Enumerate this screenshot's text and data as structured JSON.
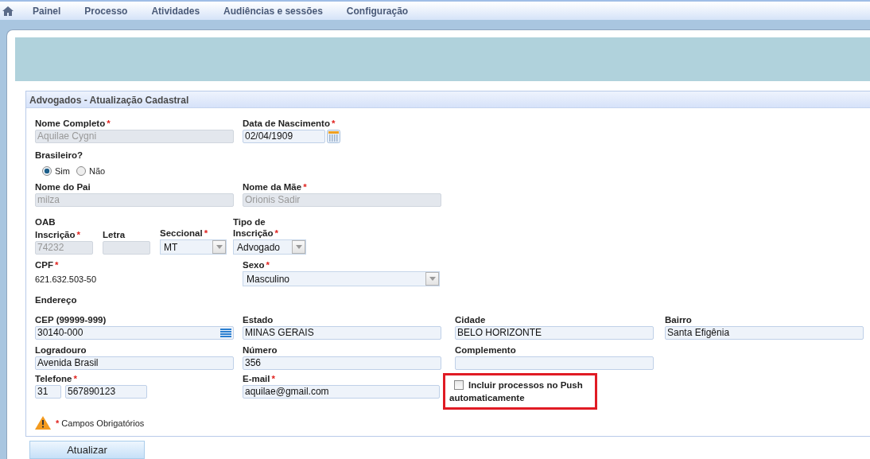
{
  "nav": {
    "items": [
      {
        "label": "Painel"
      },
      {
        "label": "Processo"
      },
      {
        "label": "Atividades"
      },
      {
        "label": "Audiências e sessões"
      },
      {
        "label": "Configuração"
      }
    ]
  },
  "panel": {
    "title": "Advogados - Atualização Cadastral"
  },
  "full_name": {
    "label": "Nome Completo",
    "mark": "*",
    "value": "Aquilae Cygni",
    "disabled": true
  },
  "birth_date": {
    "label": "Data de Nascimento",
    "mark": "*",
    "value": "02/04/1909",
    "disabled": false
  },
  "brazilian": {
    "label": "Brasileiro?",
    "options": [
      {
        "label": "Sim",
        "selected": true
      },
      {
        "label": "Não",
        "selected": false
      }
    ]
  },
  "father": {
    "label": "Nome do Pai",
    "value": "milza",
    "disabled": true
  },
  "mother": {
    "label": "Nome da Mãe",
    "mark": "*",
    "value": "Orionis Sadir",
    "disabled": true
  },
  "oab": {
    "heading": "OAB",
    "fields": [
      {
        "kind": "text",
        "label": "Inscrição",
        "mark": "*",
        "value": "74232",
        "disabled": true
      },
      {
        "kind": "text",
        "label": "Letra",
        "disabled": true
      },
      {
        "kind": "select",
        "label": "Seccional",
        "mark": "*",
        "value": "MT"
      },
      {
        "kind": "select",
        "label": "Tipo de Inscrição",
        "mark": "*",
        "value": "Advogado"
      }
    ]
  },
  "cpf": {
    "label": "CPF",
    "mark": "*",
    "value": "621.632.503-50"
  },
  "sex": {
    "label": "Sexo",
    "mark": "*",
    "value": "Masculino"
  },
  "address": {
    "heading": "Endereço",
    "fields": [
      {
        "kind": "lookup",
        "label": "CEP (99999-999)",
        "value": "30140-000"
      },
      {
        "kind": "text",
        "label": "Estado",
        "value": "MINAS GERAIS"
      },
      {
        "kind": "text",
        "label": "Cidade",
        "value": "BELO HORIZONTE"
      },
      {
        "kind": "text",
        "label": "Bairro",
        "value": "Santa Efigênia"
      },
      {
        "kind": "text",
        "label": "Logradouro",
        "value": "Avenida Brasil"
      },
      {
        "kind": "text",
        "label": "Número",
        "value": "356"
      },
      {
        "kind": "text",
        "label": "Complemento"
      }
    ]
  },
  "phone": {
    "label": "Telefone",
    "mark": "*",
    "area": "31",
    "number": "567890123"
  },
  "email": {
    "label": "E-mail",
    "mark": "*",
    "value": "aquilae@gmail.com"
  },
  "push": {
    "label": "Incluir processos no Push automaticamente",
    "checked": false,
    "highlighted": true
  },
  "required_note": {
    "mark": "*",
    "text": "Campos Obrigatórios"
  },
  "submit": {
    "label": "Atualizar"
  }
}
